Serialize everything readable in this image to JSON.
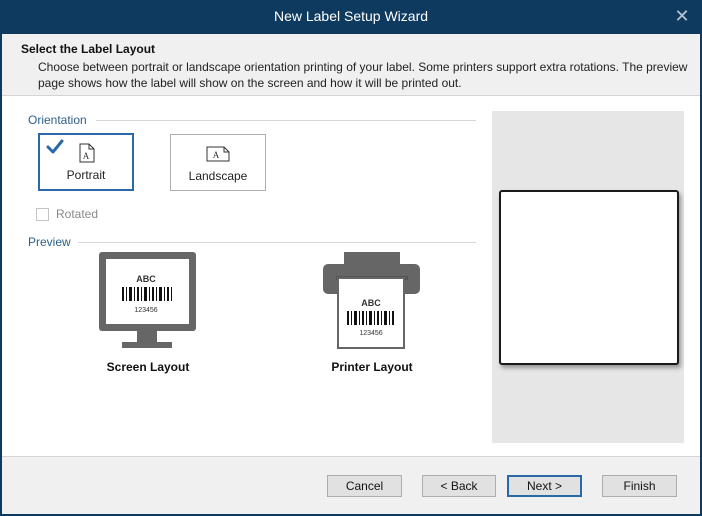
{
  "window": {
    "title": "New Label Setup Wizard",
    "close_glyph": "✕"
  },
  "header": {
    "title": "Select the Label Layout",
    "description": "Choose between portrait or landscape orientation printing of your label. Some printers support extra rotations. The preview page shows how the label will show on the screen and how it will be printed out."
  },
  "orientation": {
    "section_label": "Orientation",
    "selected": "Portrait",
    "portrait_label": "Portrait",
    "landscape_label": "Landscape",
    "page_icon_letter": "A",
    "rotated_label": "Rotated",
    "rotated_checked": false
  },
  "preview": {
    "section_label": "Preview",
    "screen_caption": "Screen Layout",
    "printer_caption": "Printer Layout",
    "sample_text": "ABC",
    "sample_number": "123456"
  },
  "footer": {
    "cancel_label": "Cancel",
    "back_label": "< Back",
    "next_label": "Next >",
    "finish_label": "Finish"
  },
  "colors": {
    "titlebar": "#0d3a5e",
    "accent": "#2b68a8",
    "section_label": "#2d5f8a",
    "device_gray": "#666666"
  },
  "icons": {
    "check": "checkmark-icon",
    "portrait": "portrait-page-icon",
    "landscape": "landscape-page-icon",
    "monitor": "monitor-icon",
    "printer": "printer-icon"
  }
}
